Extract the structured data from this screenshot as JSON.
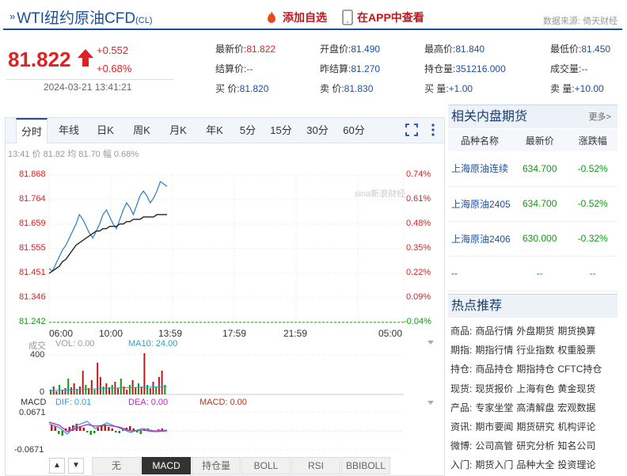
{
  "header": {
    "title": "WTI纽约原油CFD",
    "code": "(CL)",
    "add_watch": "添加自选",
    "app_view": "在APP中查看",
    "source": "数据来源: 倚天财经"
  },
  "quote": {
    "price": "81.822",
    "change": "+0.552",
    "change_pct": "+0.68%",
    "time": "2024-03-21 13:41:21",
    "fields": [
      {
        "label": "最新价:",
        "value": "81.822"
      },
      {
        "label": "开盘价:",
        "value": "81.490"
      },
      {
        "label": "最高价:",
        "value": "81.840"
      },
      {
        "label": "最低价:",
        "value": "81.450"
      },
      {
        "label": "结算价:",
        "value": "--"
      },
      {
        "label": "昨结算:",
        "value": "81.270"
      },
      {
        "label": "持仓量:",
        "value": "351216.000"
      },
      {
        "label": "成交量:",
        "value": "--"
      },
      {
        "label": "买  价:",
        "value": "81.820"
      },
      {
        "label": "卖  价:",
        "value": "81.830"
      },
      {
        "label": "买  量:",
        "value": "+1.00"
      },
      {
        "label": "卖  量:",
        "value": "+10.00"
      }
    ]
  },
  "chart_tabs": [
    "分时",
    "年线",
    "日K",
    "周K",
    "月K",
    "年K",
    "5分",
    "15分",
    "30分",
    "60分"
  ],
  "chart_info": "13:41 价 81.82 均 81.70 幅 0.68%",
  "colors": {
    "up": "#dd2222",
    "down": "#119911",
    "price_line": "#2b7bbf",
    "avg_line": "#222222",
    "brand": "#1a4f9c"
  },
  "chart_data": {
    "type": "line",
    "y_left_ticks": [
      "81.868",
      "81.764",
      "81.659",
      "81.555",
      "81.451",
      "81.346",
      "81.242"
    ],
    "y_right_ticks": [
      "0.74%",
      "0.61%",
      "0.48%",
      "0.35%",
      "0.22%",
      "0.09%",
      "-0.04%"
    ],
    "x_ticks": [
      "06:00",
      "10:00",
      "13:59",
      "17:59",
      "21:59",
      "05:00"
    ],
    "ylim": [
      81.242,
      81.868
    ],
    "series": [
      {
        "name": "价",
        "values": [
          81.47,
          81.46,
          81.49,
          81.52,
          81.55,
          81.57,
          81.6,
          81.63,
          81.66,
          81.7,
          81.68,
          81.65,
          81.62,
          81.6,
          81.63,
          81.66,
          81.7,
          81.72,
          81.69,
          81.66,
          81.64,
          81.68,
          81.72,
          81.75,
          81.73,
          81.7,
          81.74,
          81.78,
          81.8,
          81.78,
          81.75,
          81.77,
          81.8,
          81.84,
          81.83,
          81.82
        ]
      },
      {
        "name": "均",
        "values": [
          81.45,
          81.46,
          81.47,
          81.48,
          81.5,
          81.51,
          81.53,
          81.55,
          81.57,
          81.58,
          81.59,
          81.6,
          81.61,
          81.62,
          81.63,
          81.63,
          81.64,
          81.64,
          81.65,
          81.65,
          81.65,
          81.66,
          81.66,
          81.67,
          81.67,
          81.68,
          81.68,
          81.68,
          81.69,
          81.69,
          81.69,
          81.69,
          81.7,
          81.7,
          81.7,
          81.7
        ]
      }
    ]
  },
  "volume": {
    "label": "成交",
    "vol": "VOL: 0.00",
    "ma10": "MA10: 24.00",
    "ymax": "400",
    "ymin": "0"
  },
  "macd": {
    "label": "MACD",
    "dif": "DIF: 0.01",
    "dea": "DEA: 0.00",
    "macd_val": "MACD: 0.00",
    "ymax": "0.0671",
    "ymin": "-0.0671"
  },
  "bottom_tabs": [
    "无",
    "MACD",
    "持仓量",
    "BOLL",
    "RSI",
    "BBIBOLL"
  ],
  "related": {
    "title": "相关内盘期货",
    "more": "更多>",
    "columns": [
      "品种名称",
      "最新价",
      "涨跌幅"
    ],
    "rows": [
      {
        "name": "上海原油连续",
        "price": "634.700",
        "chg": "-0.52%"
      },
      {
        "name": "上海原油2405",
        "price": "634.700",
        "chg": "-0.52%"
      },
      {
        "name": "上海原油2406",
        "price": "630.000",
        "chg": "-0.32%"
      },
      {
        "name": "--",
        "price": "--",
        "chg": "--"
      }
    ]
  },
  "hot": {
    "title": "热点推荐",
    "rows": [
      {
        "cat": "商品:",
        "items": [
          "商品行情",
          "外盘期货",
          "期货换算"
        ]
      },
      {
        "cat": "期指:",
        "items": [
          "期指行情",
          "行业指数",
          "权重股票"
        ]
      },
      {
        "cat": "持仓:",
        "items": [
          "商品持仓",
          "期指持仓",
          "CFTC持仓"
        ]
      },
      {
        "cat": "现货:",
        "items": [
          "现货报价",
          "上海有色",
          "黄金现货"
        ]
      },
      {
        "cat": "产品:",
        "items": [
          "专家坐堂",
          "高清解盘",
          "宏观数据"
        ]
      },
      {
        "cat": "资讯:",
        "items": [
          "期市要闻",
          "期货研究",
          "机构评论"
        ]
      },
      {
        "cat": "微博:",
        "items": [
          "公司高管",
          "研究分析",
          "知名公司"
        ]
      },
      {
        "cat": "入门:",
        "items": [
          "期货入门",
          "品种大全",
          "投资理论"
        ]
      }
    ]
  }
}
